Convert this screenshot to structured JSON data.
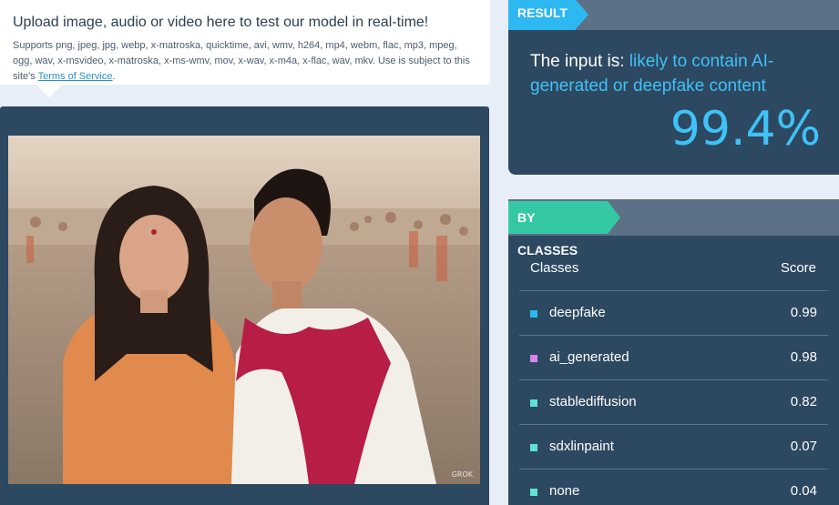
{
  "upload": {
    "title": "Upload image, audio or video here to test our model in real-time!",
    "description": "Supports png, jpeg, jpg, webp, x-matroska, quicktime, avi, wmv, h264, mp4, webm, flac, mp3, mpeg, ogg, wav, x-msvideo, x-matroska, x-ms-wmv, mov, x-wav, x-m4a, x-flac, wav, mkv. Use is subject to this site's",
    "tos_link": "Terms of Service",
    "tos_suffix": "."
  },
  "preview": {
    "watermark": "GROK"
  },
  "result": {
    "tag": "RESULT",
    "verdict_prefix": "The input is:",
    "verdict_value": "likely to contain AI-generated or deepfake content",
    "percent": "99.4%"
  },
  "classes": {
    "tag": "BY CLASSES",
    "col_classes": "Classes",
    "col_score": "Score",
    "rows": [
      {
        "name": "deepfake",
        "score": "0.99",
        "color": "#2db8f2"
      },
      {
        "name": "ai_generated",
        "score": "0.98",
        "color": "#d884e8"
      },
      {
        "name": "stablediffusion",
        "score": "0.82",
        "color": "#5fe3d4"
      },
      {
        "name": "sdxlinpaint",
        "score": "0.07",
        "color": "#5fe3d4"
      },
      {
        "name": "none",
        "score": "0.04",
        "color": "#5fe3d4"
      }
    ]
  },
  "colors": {
    "panel": "#2d4861",
    "accent_blue": "#2db8f2",
    "accent_green": "#34c9a4"
  }
}
